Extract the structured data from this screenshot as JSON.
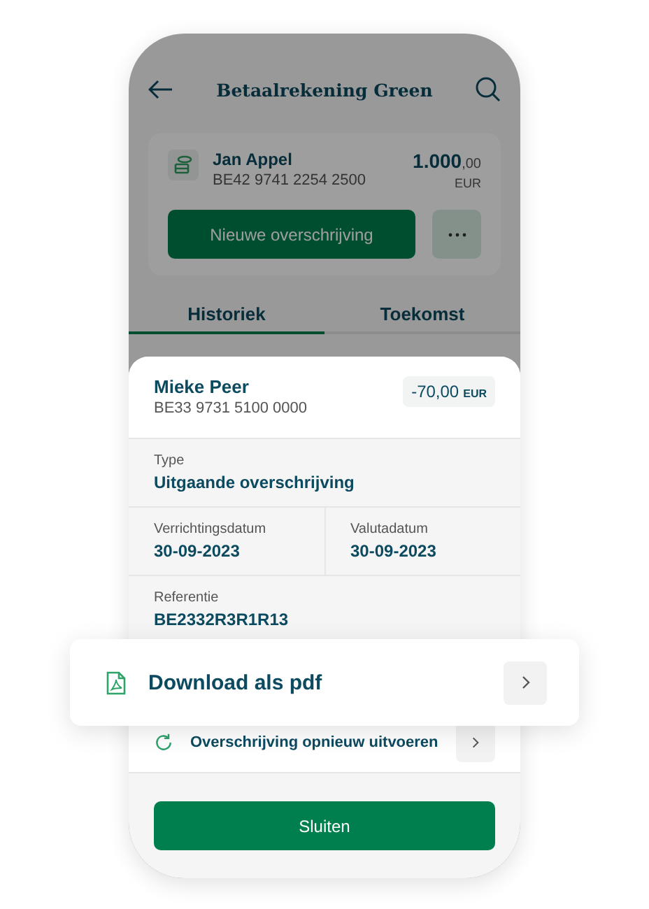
{
  "header": {
    "title": "Betaalrekening Green"
  },
  "account": {
    "name": "Jan Appel",
    "iban": "BE42 9741 2254 2500",
    "amount": "1.000",
    "decimals": ",00",
    "currency": "EUR",
    "primary_action": "Nieuwe overschrijving"
  },
  "tabs": [
    {
      "label": "Historiek",
      "selected": true
    },
    {
      "label": "Toekomst",
      "selected": false
    }
  ],
  "detail": {
    "name": "Mieke Peer",
    "iban": "BE33 9731 5100 0000",
    "amount": "-70,00",
    "currency": "EUR",
    "rows": [
      [
        {
          "label": "Type",
          "value": "Uitgaande overschrijving"
        }
      ],
      [
        {
          "label": "Verrichtingsdatum",
          "value": "30-09-2023"
        },
        {
          "label": "Valutadatum",
          "value": "30-09-2023"
        }
      ],
      [
        {
          "label": "Referentie",
          "value": "BE2332R3R1R13"
        }
      ]
    ],
    "actions": [
      {
        "kind": "repeat",
        "label": "Overschrijving opnieuw uitvoeren"
      }
    ],
    "close_button": "Sluiten"
  },
  "download_card": {
    "kind": "pdf",
    "label": "Download als pdf"
  }
}
